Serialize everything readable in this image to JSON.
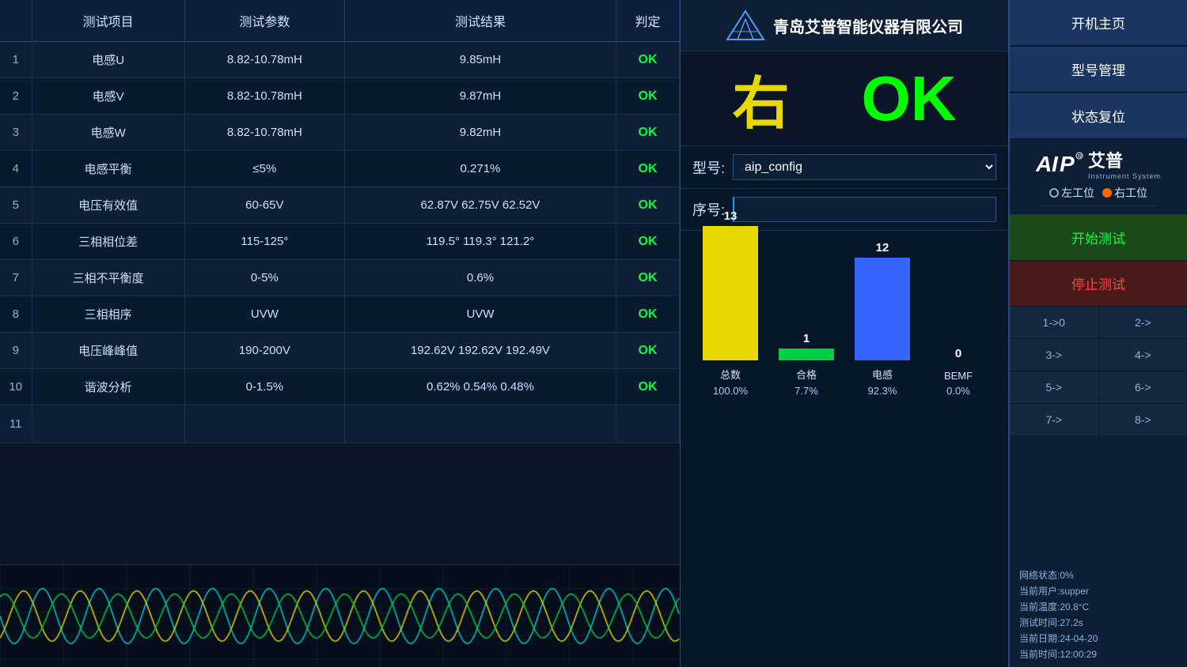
{
  "table": {
    "headers": [
      "测试项目",
      "测试参数",
      "测试结果",
      "判定"
    ],
    "rows": [
      {
        "id": "1",
        "item": "电感U",
        "param": "8.82-10.78mH",
        "result": "9.85mH",
        "judge": "OK"
      },
      {
        "id": "2",
        "item": "电感V",
        "param": "8.82-10.78mH",
        "result": "9.87mH",
        "judge": "OK"
      },
      {
        "id": "3",
        "item": "电感W",
        "param": "8.82-10.78mH",
        "result": "9.82mH",
        "judge": "OK"
      },
      {
        "id": "4",
        "item": "电感平衡",
        "param": "≤5%",
        "result": "0.271%",
        "judge": "OK"
      },
      {
        "id": "5",
        "item": "电压有效值",
        "param": "60-65V",
        "result": "62.87V  62.75V  62.52V",
        "judge": "OK"
      },
      {
        "id": "6",
        "item": "三相相位差",
        "param": "115-125°",
        "result": "119.5°  119.3°  121.2°",
        "judge": "OK"
      },
      {
        "id": "7",
        "item": "三相不平衡度",
        "param": "0-5%",
        "result": "0.6%",
        "judge": "OK"
      },
      {
        "id": "8",
        "item": "三相相序",
        "param": "UVW",
        "result": "UVW",
        "judge": "OK"
      },
      {
        "id": "9",
        "item": "电压峰峰值",
        "param": "190-200V",
        "result": "192.62V  192.62V  192.49V",
        "judge": "OK"
      },
      {
        "id": "10",
        "item": "谐波分析",
        "param": "0-1.5%",
        "result": "0.62%  0.54%  0.48%",
        "judge": "OK"
      },
      {
        "id": "11",
        "item": "",
        "param": "",
        "result": "",
        "judge": ""
      }
    ]
  },
  "middle": {
    "company_name": "青岛艾普智能仪器有限公司",
    "direction": "右",
    "result": "OK",
    "model_label": "型号:",
    "model_value": "aip_config",
    "seq_label": "序号:",
    "seq_placeholder": "",
    "chart": {
      "bars": [
        {
          "label": "总数",
          "num": "13",
          "pct": "100.0%",
          "color": "#e8d800",
          "height": 170
        },
        {
          "label": "合格",
          "num": "1",
          "pct": "7.7%",
          "color": "#00cc44",
          "height": 15
        },
        {
          "label": "电感",
          "num": "12",
          "pct": "92.3%",
          "color": "#3366ff",
          "height": 130
        },
        {
          "label": "BEMF",
          "num": "0",
          "pct": "0.0%",
          "color": "#00cccc",
          "height": 0
        }
      ]
    }
  },
  "right": {
    "nav": {
      "home_label": "开机主页",
      "model_label": "型号管理",
      "reset_label": "状态复位"
    },
    "brand": {
      "aip_label": "AIP",
      "chinese_label": "艾普",
      "sub_label": "Instrument System"
    },
    "station": {
      "left_label": "左工位",
      "right_label": "右工位"
    },
    "actions": {
      "start_label": "开始测试",
      "stop_label": "停止测试"
    },
    "shortcuts": [
      {
        "id": "1",
        "label": "1->0"
      },
      {
        "id": "2",
        "label": "2->"
      },
      {
        "id": "3",
        "label": "3->"
      },
      {
        "id": "4",
        "label": "4->"
      },
      {
        "id": "5",
        "label": "5->"
      },
      {
        "id": "6",
        "label": "6->"
      },
      {
        "id": "7",
        "label": "7->"
      },
      {
        "id": "8",
        "label": "8->"
      }
    ],
    "status": {
      "network": "网络状态:0%",
      "user": "当前用户:supper",
      "temperature": "当前温度:20.8°C",
      "test_time": "测试时间:27.2s",
      "date": "当前日期:24-04-20",
      "time": "当前时间:12:00:29"
    }
  }
}
